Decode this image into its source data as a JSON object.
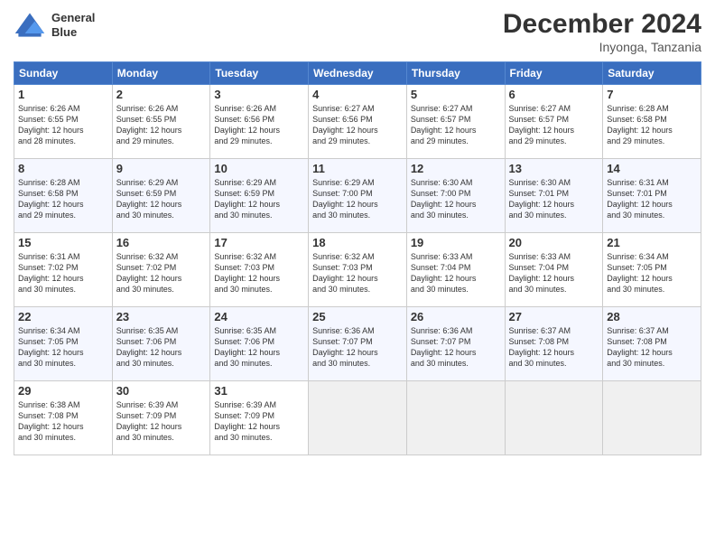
{
  "header": {
    "logo_line1": "General",
    "logo_line2": "Blue",
    "month": "December 2024",
    "location": "Inyonga, Tanzania"
  },
  "weekdays": [
    "Sunday",
    "Monday",
    "Tuesday",
    "Wednesday",
    "Thursday",
    "Friday",
    "Saturday"
  ],
  "weeks": [
    [
      {
        "day": "1",
        "info": "Sunrise: 6:26 AM\nSunset: 6:55 PM\nDaylight: 12 hours\nand 28 minutes."
      },
      {
        "day": "2",
        "info": "Sunrise: 6:26 AM\nSunset: 6:55 PM\nDaylight: 12 hours\nand 29 minutes."
      },
      {
        "day": "3",
        "info": "Sunrise: 6:26 AM\nSunset: 6:56 PM\nDaylight: 12 hours\nand 29 minutes."
      },
      {
        "day": "4",
        "info": "Sunrise: 6:27 AM\nSunset: 6:56 PM\nDaylight: 12 hours\nand 29 minutes."
      },
      {
        "day": "5",
        "info": "Sunrise: 6:27 AM\nSunset: 6:57 PM\nDaylight: 12 hours\nand 29 minutes."
      },
      {
        "day": "6",
        "info": "Sunrise: 6:27 AM\nSunset: 6:57 PM\nDaylight: 12 hours\nand 29 minutes."
      },
      {
        "day": "7",
        "info": "Sunrise: 6:28 AM\nSunset: 6:58 PM\nDaylight: 12 hours\nand 29 minutes."
      }
    ],
    [
      {
        "day": "8",
        "info": "Sunrise: 6:28 AM\nSunset: 6:58 PM\nDaylight: 12 hours\nand 29 minutes."
      },
      {
        "day": "9",
        "info": "Sunrise: 6:29 AM\nSunset: 6:59 PM\nDaylight: 12 hours\nand 30 minutes."
      },
      {
        "day": "10",
        "info": "Sunrise: 6:29 AM\nSunset: 6:59 PM\nDaylight: 12 hours\nand 30 minutes."
      },
      {
        "day": "11",
        "info": "Sunrise: 6:29 AM\nSunset: 7:00 PM\nDaylight: 12 hours\nand 30 minutes."
      },
      {
        "day": "12",
        "info": "Sunrise: 6:30 AM\nSunset: 7:00 PM\nDaylight: 12 hours\nand 30 minutes."
      },
      {
        "day": "13",
        "info": "Sunrise: 6:30 AM\nSunset: 7:01 PM\nDaylight: 12 hours\nand 30 minutes."
      },
      {
        "day": "14",
        "info": "Sunrise: 6:31 AM\nSunset: 7:01 PM\nDaylight: 12 hours\nand 30 minutes."
      }
    ],
    [
      {
        "day": "15",
        "info": "Sunrise: 6:31 AM\nSunset: 7:02 PM\nDaylight: 12 hours\nand 30 minutes."
      },
      {
        "day": "16",
        "info": "Sunrise: 6:32 AM\nSunset: 7:02 PM\nDaylight: 12 hours\nand 30 minutes."
      },
      {
        "day": "17",
        "info": "Sunrise: 6:32 AM\nSunset: 7:03 PM\nDaylight: 12 hours\nand 30 minutes."
      },
      {
        "day": "18",
        "info": "Sunrise: 6:32 AM\nSunset: 7:03 PM\nDaylight: 12 hours\nand 30 minutes."
      },
      {
        "day": "19",
        "info": "Sunrise: 6:33 AM\nSunset: 7:04 PM\nDaylight: 12 hours\nand 30 minutes."
      },
      {
        "day": "20",
        "info": "Sunrise: 6:33 AM\nSunset: 7:04 PM\nDaylight: 12 hours\nand 30 minutes."
      },
      {
        "day": "21",
        "info": "Sunrise: 6:34 AM\nSunset: 7:05 PM\nDaylight: 12 hours\nand 30 minutes."
      }
    ],
    [
      {
        "day": "22",
        "info": "Sunrise: 6:34 AM\nSunset: 7:05 PM\nDaylight: 12 hours\nand 30 minutes."
      },
      {
        "day": "23",
        "info": "Sunrise: 6:35 AM\nSunset: 7:06 PM\nDaylight: 12 hours\nand 30 minutes."
      },
      {
        "day": "24",
        "info": "Sunrise: 6:35 AM\nSunset: 7:06 PM\nDaylight: 12 hours\nand 30 minutes."
      },
      {
        "day": "25",
        "info": "Sunrise: 6:36 AM\nSunset: 7:07 PM\nDaylight: 12 hours\nand 30 minutes."
      },
      {
        "day": "26",
        "info": "Sunrise: 6:36 AM\nSunset: 7:07 PM\nDaylight: 12 hours\nand 30 minutes."
      },
      {
        "day": "27",
        "info": "Sunrise: 6:37 AM\nSunset: 7:08 PM\nDaylight: 12 hours\nand 30 minutes."
      },
      {
        "day": "28",
        "info": "Sunrise: 6:37 AM\nSunset: 7:08 PM\nDaylight: 12 hours\nand 30 minutes."
      }
    ],
    [
      {
        "day": "29",
        "info": "Sunrise: 6:38 AM\nSunset: 7:08 PM\nDaylight: 12 hours\nand 30 minutes."
      },
      {
        "day": "30",
        "info": "Sunrise: 6:39 AM\nSunset: 7:09 PM\nDaylight: 12 hours\nand 30 minutes."
      },
      {
        "day": "31",
        "info": "Sunrise: 6:39 AM\nSunset: 7:09 PM\nDaylight: 12 hours\nand 30 minutes."
      },
      {
        "day": "",
        "info": ""
      },
      {
        "day": "",
        "info": ""
      },
      {
        "day": "",
        "info": ""
      },
      {
        "day": "",
        "info": ""
      }
    ]
  ]
}
